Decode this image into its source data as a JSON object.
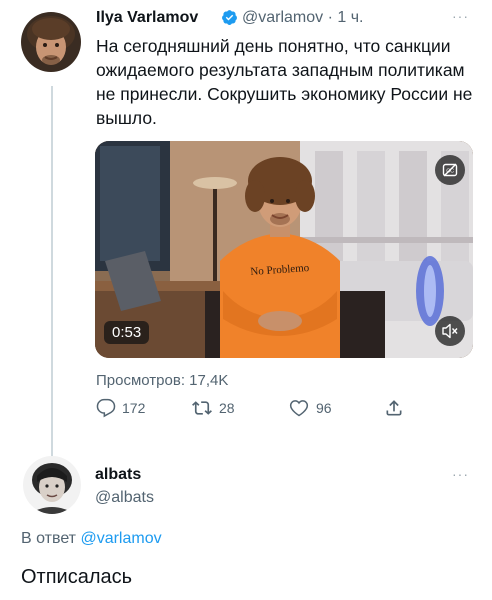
{
  "tweet": {
    "author_name": "Ilya Varlamov",
    "handle_time": "@varlamov · 1 ч.",
    "more_glyph": "···",
    "text": "На сегодняшний день понятно, что санкции ожидаемого результата западным политикам не принесли. Сокрушить экономику России не вышло.",
    "video": {
      "duration": "0:53",
      "shirt_text": "No Problemo"
    },
    "views": "Просмотров: 17,4K",
    "actions": {
      "replies": "172",
      "retweets": "28",
      "likes": "96"
    }
  },
  "reply": {
    "author_name": "albats",
    "handle": "@albats",
    "more_glyph": "···",
    "reply_prefix": "В ответ ",
    "reply_mention": "@varlamov",
    "text": "Отписалась"
  },
  "colors": {
    "verified": "#1d9bf0",
    "mention": "#1d9bf0",
    "secondary_text": "#536471",
    "shirt": "#f0822a"
  }
}
